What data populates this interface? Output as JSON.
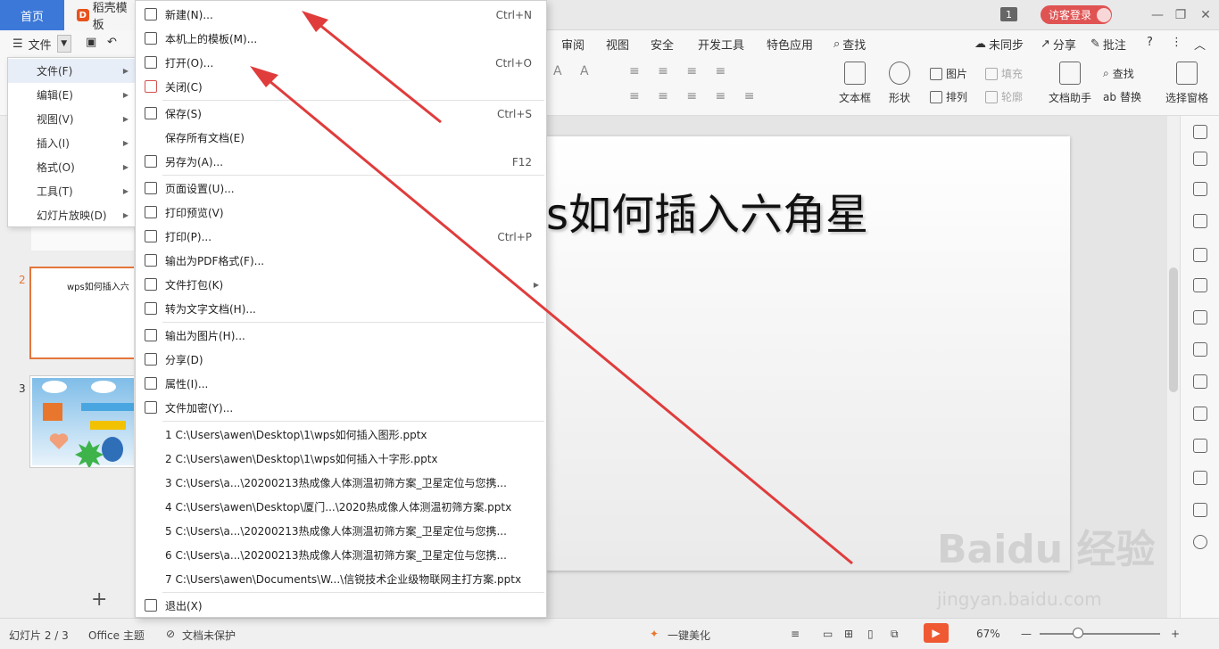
{
  "titlebar": {
    "home_tab": "首页",
    "doc_tab": "稻壳模板",
    "badge": "1",
    "login": "访客登录"
  },
  "menu": {
    "file_label": "文件",
    "tabs": [
      "审阅",
      "视图",
      "安全",
      "开发工具",
      "特色应用"
    ],
    "search": "查找",
    "right_tools": [
      "未同步",
      "分享",
      "批注"
    ]
  },
  "ribbon": {
    "textbox": "文本框",
    "shape": "形状",
    "picture": "图片",
    "arrange": "排列",
    "fill": "填充",
    "outline": "轮廓",
    "doc_helper": "文档助手",
    "find": "查找",
    "replace": "替换",
    "select_pane": "选择窗格"
  },
  "submenu": {
    "items": [
      {
        "label": "文件(F)",
        "active": true
      },
      {
        "label": "编辑(E)",
        "active": false
      },
      {
        "label": "视图(V)",
        "active": false
      },
      {
        "label": "插入(I)",
        "active": false
      },
      {
        "label": "格式(O)",
        "active": false
      },
      {
        "label": "工具(T)",
        "active": false
      },
      {
        "label": "幻灯片放映(D)",
        "active": false
      }
    ]
  },
  "dropdown": {
    "items": [
      {
        "label": "新建(N)...",
        "shortcut": "Ctrl+N",
        "icon": "new-file-icon"
      },
      {
        "label": "本机上的模板(M)...",
        "shortcut": "",
        "icon": "template-icon"
      },
      {
        "label": "打开(O)...",
        "shortcut": "Ctrl+O",
        "icon": "folder-open-icon"
      },
      {
        "label": "关闭(C)",
        "shortcut": "",
        "icon": "close-doc-icon"
      },
      {
        "label": "保存(S)",
        "shortcut": "Ctrl+S",
        "icon": "save-icon"
      },
      {
        "label": "保存所有文档(E)",
        "shortcut": "",
        "icon": ""
      },
      {
        "label": "另存为(A)...",
        "shortcut": "F12",
        "icon": "save-as-icon"
      },
      {
        "label": "页面设置(U)...",
        "shortcut": "",
        "icon": "page-setup-icon"
      },
      {
        "label": "打印预览(V)",
        "shortcut": "",
        "icon": "print-preview-icon"
      },
      {
        "label": "打印(P)...",
        "shortcut": "Ctrl+P",
        "icon": "print-icon"
      },
      {
        "label": "输出为PDF格式(F)...",
        "shortcut": "",
        "icon": "pdf-icon"
      },
      {
        "label": "文件打包(K)",
        "shortcut": "",
        "icon": "package-icon"
      },
      {
        "label": "转为文字文档(H)...",
        "shortcut": "",
        "icon": "to-word-icon"
      },
      {
        "label": "输出为图片(H)...",
        "shortcut": "",
        "icon": "export-image-icon"
      },
      {
        "label": "分享(D)",
        "shortcut": "",
        "icon": "share-icon"
      },
      {
        "label": "属性(I)...",
        "shortcut": "",
        "icon": "properties-icon"
      },
      {
        "label": "文件加密(Y)...",
        "shortcut": "",
        "icon": "encrypt-icon"
      }
    ],
    "recent": [
      "1 C:\\Users\\awen\\Desktop\\1\\wps如何插入图形.pptx",
      "2 C:\\Users\\awen\\Desktop\\1\\wps如何插入十字形.pptx",
      "3 C:\\Users\\a...\\20200213热成像人体测温初筛方案_卫星定位与您携...",
      "4 C:\\Users\\awen\\Desktop\\厦门...\\2020热成像人体测温初筛方案.pptx",
      "5 C:\\Users\\a...\\20200213热成像人体测温初筛方案_卫星定位与您携...",
      "6 C:\\Users\\a...\\20200213热成像人体测温初筛方案_卫星定位与您携...",
      "7 C:\\Users\\awen\\Documents\\W...\\信锐技术企业级物联网主打方案.pptx"
    ],
    "exit": "退出(X)"
  },
  "slides": {
    "numbers": [
      "2",
      "3"
    ],
    "thumb2_title": "wps如何插入六",
    "current_title": "s如何插入六角星"
  },
  "status": {
    "slide_count": "幻灯片 2 / 3",
    "theme": "Office 主题",
    "protect": "文档未保护",
    "beautify": "一键美化",
    "zoom": "67%"
  },
  "watermark": {
    "main": "Baidu 经验",
    "sub": "jingyan.baidu.com"
  },
  "colors": {
    "accent": "#3c78d8",
    "arrow": "#e03c3c",
    "play": "#ef5a33",
    "slide_select": "#e4753a"
  }
}
